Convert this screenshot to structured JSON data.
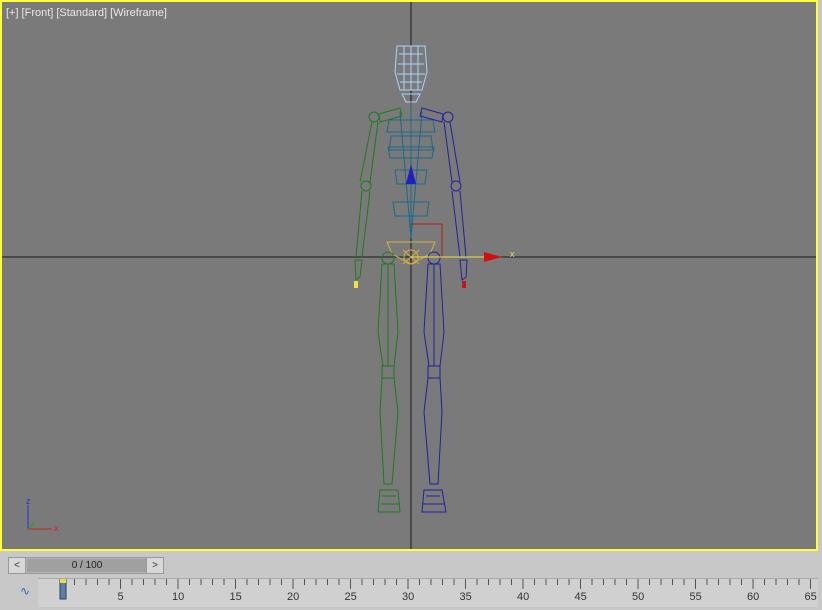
{
  "viewport": {
    "labels": [
      "[+]",
      "[Front]",
      "[Standard]",
      "[Wireframe]"
    ],
    "gizmo_axis_label": "x",
    "triad": {
      "z": "z",
      "x": "x",
      "y": "y"
    },
    "colors": {
      "background": "#7a7a7a",
      "active_border": "#ffff3c",
      "left_limbs": "#1e7a1e",
      "right_limbs": "#2020a0",
      "spine": "#1a6a8a",
      "head": "#aad4ff",
      "pelvis": "#d4b040"
    }
  },
  "timeline": {
    "prev_label": "<",
    "next_label": ">",
    "frame_display": "0 / 100",
    "current_frame": 0,
    "total_frames": 100,
    "tick_labels": [
      "5",
      "10",
      "15",
      "20",
      "25",
      "30",
      "35",
      "40",
      "45",
      "50",
      "55",
      "60",
      "65"
    ],
    "curve_icon": "curve-editor-icon"
  }
}
